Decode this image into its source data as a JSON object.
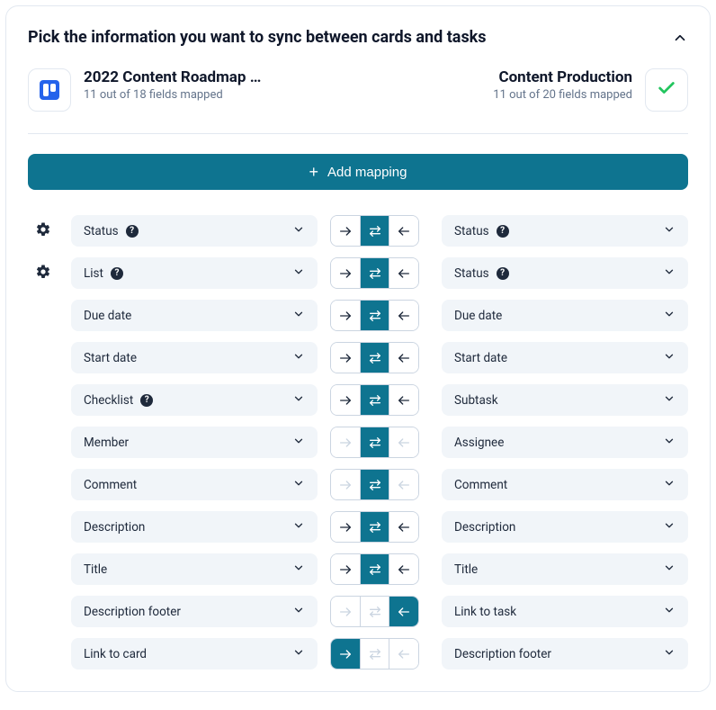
{
  "header": {
    "title": "Pick the information you want to sync between cards and tasks"
  },
  "source": {
    "name": "2022 Content Roadmap …",
    "sub": "11 out of 18 fields mapped"
  },
  "dest": {
    "name": "Content Production",
    "sub": "11 out of 20 fields mapped"
  },
  "addButton": "Add mapping",
  "rows": [
    {
      "left": "Status",
      "right": "Status",
      "leftHelp": true,
      "rightHelp": true,
      "gear": true,
      "dir": "both",
      "dimOthers": false
    },
    {
      "left": "List",
      "right": "Status",
      "leftHelp": true,
      "rightHelp": true,
      "gear": true,
      "dir": "both",
      "dimOthers": false
    },
    {
      "left": "Due date",
      "right": "Due date",
      "leftHelp": false,
      "rightHelp": false,
      "gear": false,
      "dir": "both",
      "dimOthers": false
    },
    {
      "left": "Start date",
      "right": "Start date",
      "leftHelp": false,
      "rightHelp": false,
      "gear": false,
      "dir": "both",
      "dimOthers": false
    },
    {
      "left": "Checklist",
      "right": "Subtask",
      "leftHelp": true,
      "rightHelp": false,
      "gear": false,
      "dir": "both",
      "dimOthers": false
    },
    {
      "left": "Member",
      "right": "Assignee",
      "leftHelp": false,
      "rightHelp": false,
      "gear": false,
      "dir": "both",
      "dimOthers": true
    },
    {
      "left": "Comment",
      "right": "Comment",
      "leftHelp": false,
      "rightHelp": false,
      "gear": false,
      "dir": "both",
      "dimOthers": true
    },
    {
      "left": "Description",
      "right": "Description",
      "leftHelp": false,
      "rightHelp": false,
      "gear": false,
      "dir": "both",
      "dimOthers": false
    },
    {
      "left": "Title",
      "right": "Title",
      "leftHelp": false,
      "rightHelp": false,
      "gear": false,
      "dir": "both",
      "dimOthers": false
    },
    {
      "left": "Description footer",
      "right": "Link to task",
      "leftHelp": false,
      "rightHelp": false,
      "gear": false,
      "dir": "left",
      "dimOthers": true
    },
    {
      "left": "Link to card",
      "right": "Description footer",
      "leftHelp": false,
      "rightHelp": false,
      "gear": false,
      "dir": "right",
      "dimOthers": true
    }
  ]
}
